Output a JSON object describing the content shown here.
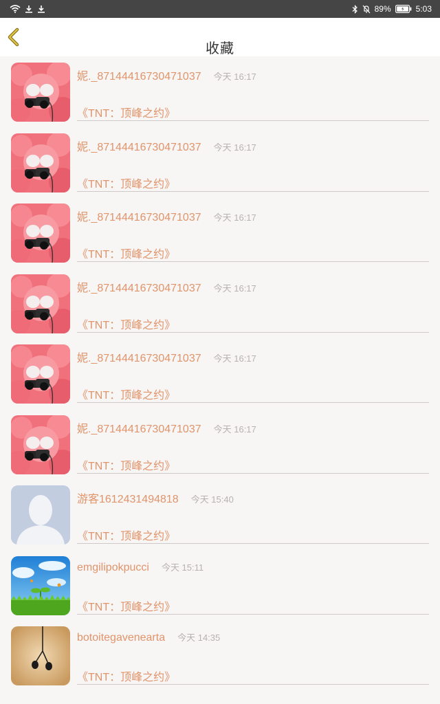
{
  "status_bar": {
    "battery": "89%",
    "time": "5:03"
  },
  "header": {
    "title": "收藏"
  },
  "colors": {
    "accent": "#e0946a",
    "time_gray": "#b7b2b2",
    "back_icon": "#c9a82a"
  },
  "items": [
    {
      "name": "妮._87144416730471037",
      "time": "今天 16:17",
      "book": "《TNT：顶峰之约》",
      "avatar_icon": "binoculars-avatar-icon"
    },
    {
      "name": "妮._87144416730471037",
      "time": "今天 16:17",
      "book": "《TNT：顶峰之约》",
      "avatar_icon": "binoculars-avatar-icon"
    },
    {
      "name": "妮._87144416730471037",
      "time": "今天 16:17",
      "book": "《TNT：顶峰之约》",
      "avatar_icon": "binoculars-avatar-icon"
    },
    {
      "name": "妮._87144416730471037",
      "time": "今天 16:17",
      "book": "《TNT：顶峰之约》",
      "avatar_icon": "binoculars-avatar-icon"
    },
    {
      "name": "妮._87144416730471037",
      "time": "今天 16:17",
      "book": "《TNT：顶峰之约》",
      "avatar_icon": "binoculars-avatar-icon"
    },
    {
      "name": "妮._87144416730471037",
      "time": "今天 16:17",
      "book": "《TNT：顶峰之约》",
      "avatar_icon": "binoculars-avatar-icon"
    },
    {
      "name": "游客1612431494818",
      "time": "今天 15:40",
      "book": "《TNT：顶峰之约》",
      "avatar_icon": "default-user-avatar-icon"
    },
    {
      "name": "emgilipokpucci",
      "time": "今天 15:11",
      "book": "《TNT：顶峰之约》",
      "avatar_icon": "sprout-avatar-icon"
    },
    {
      "name": "botoitegavenearta",
      "time": "今天 14:35",
      "book": "《TNT：顶峰之约》",
      "avatar_icon": "earphones-avatar-icon"
    }
  ]
}
